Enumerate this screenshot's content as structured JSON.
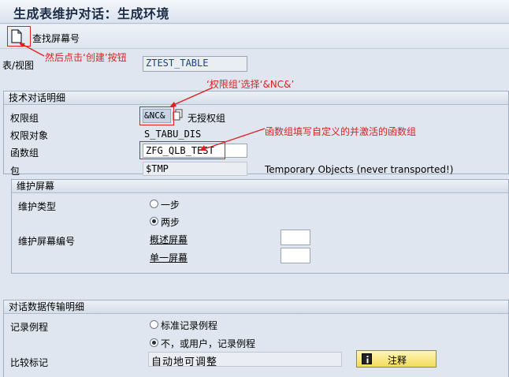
{
  "window": {
    "title": "生成表维护对话：生成环境"
  },
  "toolbar": {
    "create_icon": "new-document-icon",
    "find_screen_label": "查找屏幕号"
  },
  "header": {
    "table_view_label": "表/视图",
    "table_view_value": "ZTEST_TABLE"
  },
  "tech_details": {
    "title": "技术对话明细",
    "auth_group_label": "权限组",
    "auth_group_value": "&NC&",
    "auth_group_desc": "无授权组",
    "auth_object_label": "权限对象",
    "auth_object_value": "S_TABU_DIS",
    "function_group_label": "函数组",
    "function_group_value": "ZFG_QLB_TEST",
    "package_label": "包",
    "package_value": "$TMP",
    "package_desc": "Temporary Objects (never transported!)"
  },
  "maint_screen": {
    "title": "维护屏幕",
    "type_label": "维护类型",
    "type_option_one": "一步",
    "type_option_two": "两步",
    "selected_type": "two",
    "screen_number_label": "维护屏幕编号",
    "overview_screen_label": "概述屏幕",
    "overview_screen_value": "",
    "single_screen_label": "单一屏幕",
    "single_screen_value": ""
  },
  "transfer": {
    "title": "对话数据传输明细",
    "routine_label": "记录例程",
    "routine_option_std": "标准记录例程",
    "routine_option_none": "不，或用户，记录例程",
    "selected_routine": "none",
    "compare_label": "比较标记",
    "compare_value": "自动地可调整",
    "comment_button_label": "注释",
    "comment_icon": "info-icon"
  },
  "annotations": {
    "create_hint": "然后点击‘创建’按钮",
    "auth_group_hint": "‘权限组’选择‘&NC&’",
    "function_group_hint": "函数组填写自定义的并激活的函数组"
  },
  "colors": {
    "annotation": "#e02020",
    "title": "#1c2b46",
    "button": "#f2db5c"
  }
}
